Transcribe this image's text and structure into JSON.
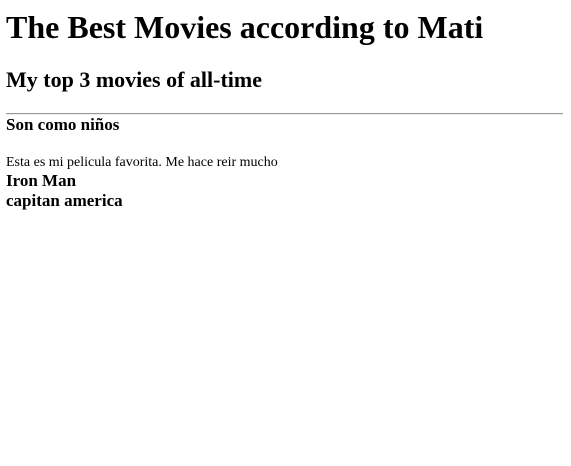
{
  "page": {
    "title": "The Best Movies according to Mati",
    "subtitle": "My top 3 movies of all-time"
  },
  "movies": [
    {
      "title": "Son como niños",
      "description": "Esta es mi pelicula favorita. Me hace reir mucho"
    },
    {
      "title": "Iron Man"
    },
    {
      "title": "capitan america"
    }
  ],
  "colors": {
    "background": "#ffffff",
    "text": "#000000",
    "divider": "#9a9a9a"
  }
}
